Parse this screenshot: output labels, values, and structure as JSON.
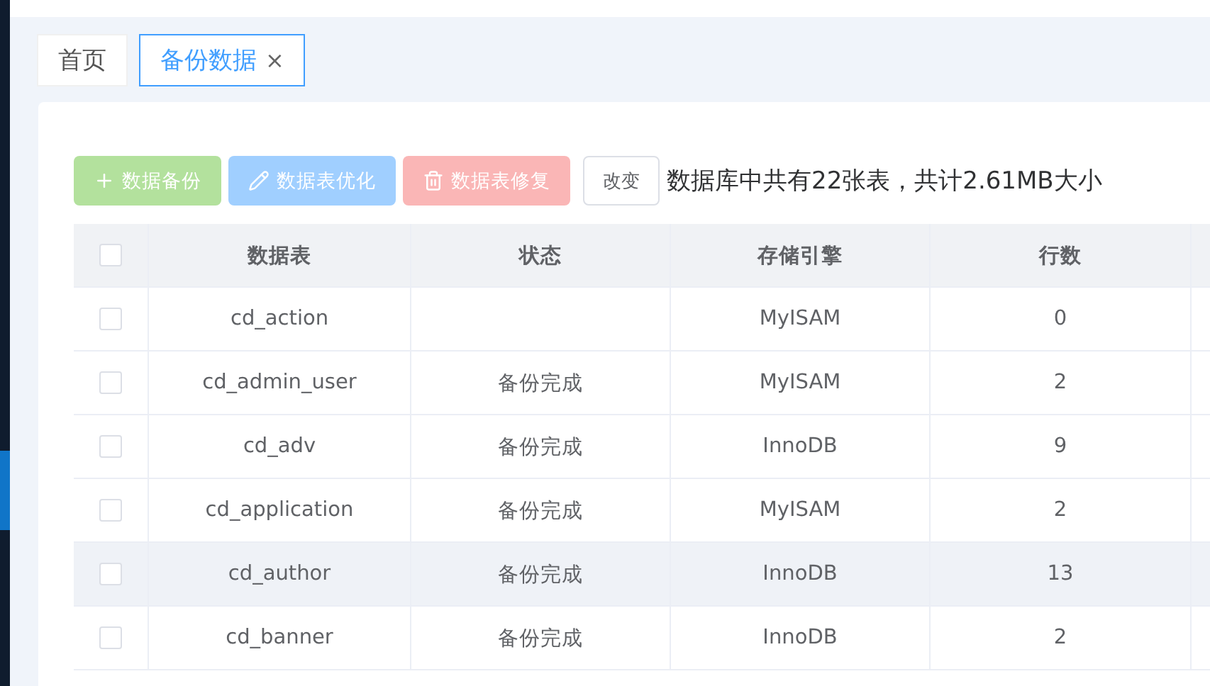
{
  "tabs": [
    {
      "label": "首页",
      "selected": false,
      "closable": false
    },
    {
      "label": "备份数据",
      "selected": true,
      "closable": true,
      "close_glyph": "×"
    }
  ],
  "toolbar": {
    "buttons": [
      {
        "kind": "add",
        "label": "数据备份",
        "disabled": true
      },
      {
        "kind": "edit",
        "label": "数据表优化",
        "disabled": true
      },
      {
        "kind": "delete",
        "label": "数据表修复",
        "disabled": true
      }
    ],
    "change_button": "改变",
    "summary": "数据库中共有22张表，共计2.61MB大小"
  },
  "table": {
    "select_all_checked": false,
    "columns": [
      "数据表",
      "状态",
      "存储引擎",
      "行数"
    ],
    "rows": [
      {
        "checked": false,
        "hovered": false,
        "cells": [
          "cd_action",
          "",
          "MyISAM",
          "0"
        ]
      },
      {
        "checked": false,
        "hovered": false,
        "cells": [
          "cd_admin_user",
          "备份完成",
          "MyISAM",
          "2"
        ]
      },
      {
        "checked": false,
        "hovered": false,
        "cells": [
          "cd_adv",
          "备份完成",
          "InnoDB",
          "9"
        ]
      },
      {
        "checked": false,
        "hovered": false,
        "cells": [
          "cd_application",
          "备份完成",
          "MyISAM",
          "2"
        ]
      },
      {
        "checked": false,
        "hovered": true,
        "cells": [
          "cd_author",
          "备份完成",
          "InnoDB",
          "13"
        ]
      },
      {
        "checked": false,
        "hovered": false,
        "cells": [
          "cd_banner",
          "备份完成",
          "InnoDB",
          "2"
        ]
      }
    ]
  }
}
